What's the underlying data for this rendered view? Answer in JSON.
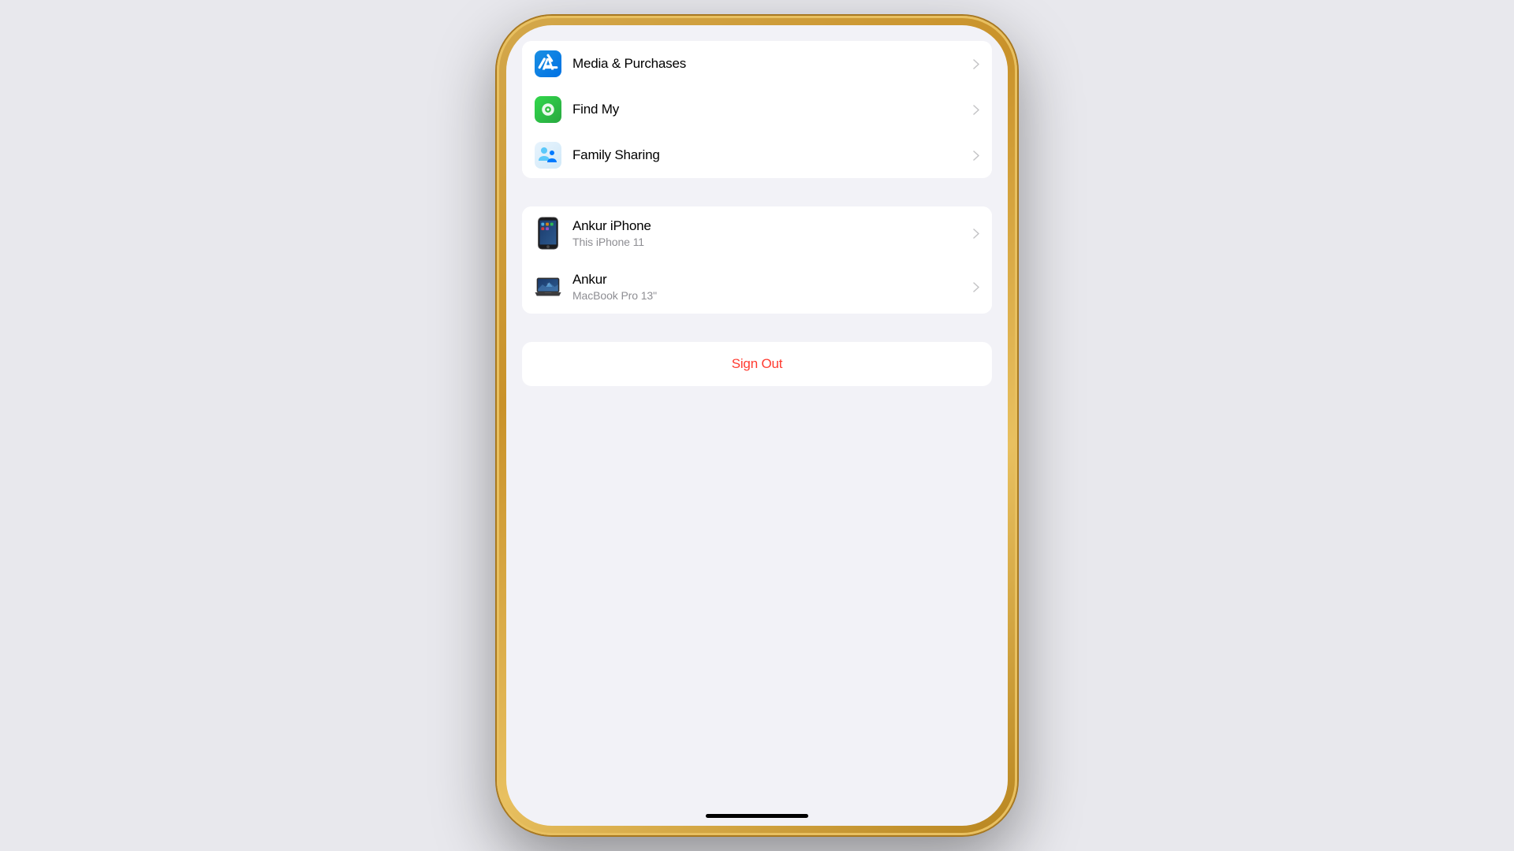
{
  "page": {
    "background_color": "#e8e8ed"
  },
  "settings_items": [
    {
      "id": "media-purchases",
      "label": "Media & Purchases",
      "icon_type": "app-store",
      "icon_color": "#0071e3"
    },
    {
      "id": "find-my",
      "label": "Find My",
      "icon_type": "find-my",
      "icon_color": "#32d74b"
    },
    {
      "id": "family-sharing",
      "label": "Family Sharing",
      "icon_type": "family",
      "icon_color": "#e8f4fd"
    }
  ],
  "devices": [
    {
      "id": "ankur-iphone",
      "name": "Ankur iPhone",
      "subtitle": "This iPhone 11",
      "icon_type": "iphone"
    },
    {
      "id": "ankur-macbook",
      "name": "Ankur",
      "subtitle": "MacBook Pro 13\"",
      "icon_type": "macbook"
    }
  ],
  "sign_out": {
    "label": "Sign Out",
    "color": "#ff3b30"
  }
}
